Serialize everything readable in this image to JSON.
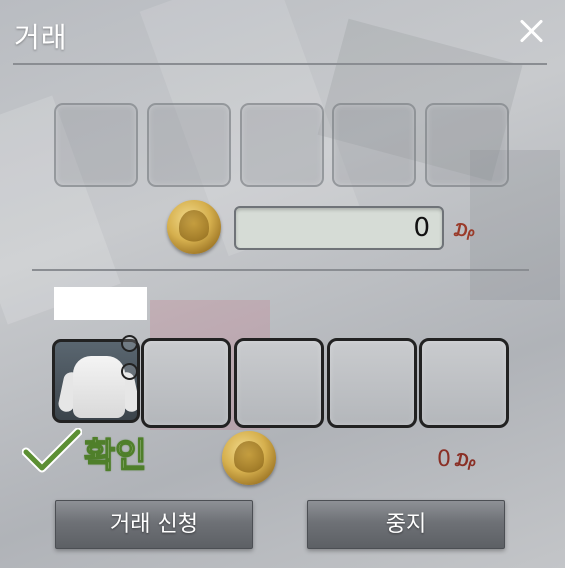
{
  "window": {
    "title": "거래",
    "close_icon": "close-icon"
  },
  "partner": {
    "slots": [
      {},
      {},
      {},
      {},
      {}
    ],
    "coin_icon": "gold-coin-icon",
    "amount_value": "0",
    "currency_symbol": "₯"
  },
  "self": {
    "name": "",
    "items": [
      {
        "icon": "white-hoodie-icon"
      },
      {},
      {},
      {},
      {}
    ],
    "confirm_icon": "checkmark-icon",
    "confirm_label": "확인",
    "coin_icon": "gold-coin-icon",
    "amount_value": "0",
    "currency_symbol": "₯"
  },
  "buttons": {
    "trade_request": "거래 신청",
    "stop": "중지"
  },
  "colors": {
    "confirm_green": "#4f7f2a",
    "amount_red": "#8a2f25",
    "button_gray": "#6e7176"
  }
}
